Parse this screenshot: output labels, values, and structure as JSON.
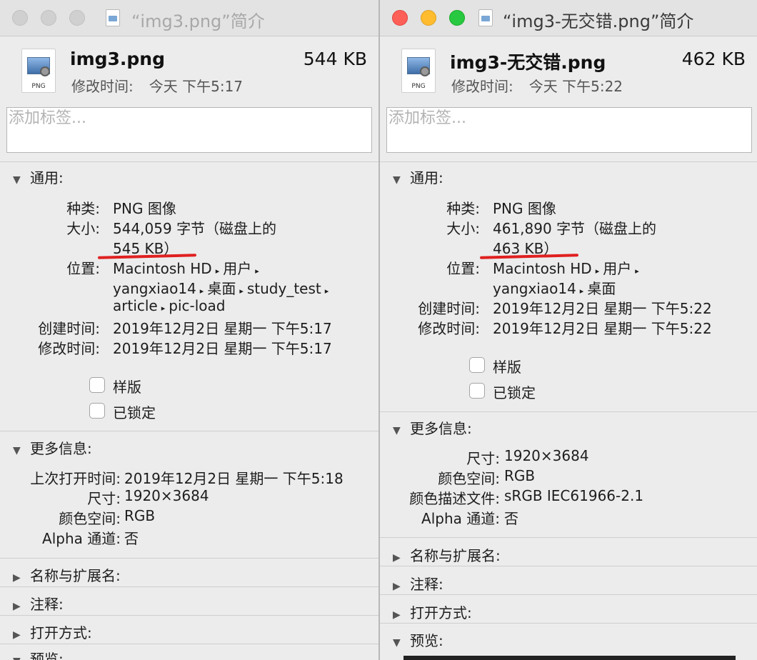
{
  "left": {
    "title": "“img3.png”简介",
    "file_name": "img3.png",
    "file_size": "544 KB",
    "file_icon_ext": "PNG",
    "modified_label": "修改时间:",
    "modified_value": "今天 下午5:17",
    "tags_placeholder": "添加标签...",
    "general": {
      "header": "通用:",
      "kind_label": "种类:",
      "kind_value": "PNG 图像",
      "size_label": "大小:",
      "size_value_1": "544,059 字节（磁盘上的",
      "size_value_2": "545 KB）",
      "where_label": "位置:",
      "where_parts": [
        "Macintosh HD",
        "用户",
        "yangxiao14",
        "桌面",
        "study_test",
        "article",
        "pic-load"
      ],
      "path_arrow": "▸",
      "created_label": "创建时间:",
      "created_value": "2019年12月2日 星期一 下午5:17",
      "modified_label": "修改时间:",
      "modified_value": "2019年12月2日 星期一 下午5:17",
      "stationery_label": "样版",
      "locked_label": "已锁定"
    },
    "more_info": {
      "header": "更多信息:",
      "last_opened_label": "上次打开时间:",
      "last_opened_value": "2019年12月2日 星期一 下午5:18",
      "dimensions_label": "尺寸:",
      "dimensions_value": "1920×3684",
      "color_space_label": "颜色空间:",
      "color_space_value": "RGB",
      "alpha_label": "Alpha 通道:",
      "alpha_value": "否"
    },
    "sections": [
      "名称与扩展名:",
      "注释:",
      "打开方式:",
      "预览:"
    ]
  },
  "right": {
    "title": "“img3-无交错.png”简介",
    "file_name": "img3-无交错.png",
    "file_size": "462 KB",
    "file_icon_ext": "PNG",
    "modified_label": "修改时间:",
    "modified_value": "今天 下午5:22",
    "tags_placeholder": "添加标签...",
    "general": {
      "header": "通用:",
      "kind_label": "种类:",
      "kind_value": "PNG 图像",
      "size_label": "大小:",
      "size_value_1": "461,890 字节（磁盘上的",
      "size_value_2": "463 KB）",
      "where_label": "位置:",
      "where_parts": [
        "Macintosh HD",
        "用户",
        "yangxiao14",
        "桌面"
      ],
      "path_arrow": "▸",
      "created_label": "创建时间:",
      "created_value": "2019年12月2日 星期一 下午5:22",
      "modified_label": "修改时间:",
      "modified_value": "2019年12月2日 星期一 下午5:22",
      "stationery_label": "样版",
      "locked_label": "已锁定"
    },
    "more_info": {
      "header": "更多信息:",
      "dimensions_label": "尺寸:",
      "dimensions_value": "1920×3684",
      "color_space_label": "颜色空间:",
      "color_space_value": "RGB",
      "color_profile_label": "颜色描述文件:",
      "color_profile_value": "sRGB IEC61966-2.1",
      "alpha_label": "Alpha 通道:",
      "alpha_value": "否"
    },
    "sections": [
      "名称与扩展名:",
      "注释:",
      "打开方式:",
      "预览:"
    ]
  },
  "icons": {
    "expanded": "▼",
    "collapsed": "▶"
  },
  "colors": {
    "annotation_red": "#e02020",
    "close": "#fe5f57",
    "minimize": "#febc2e",
    "zoom": "#28c840"
  }
}
